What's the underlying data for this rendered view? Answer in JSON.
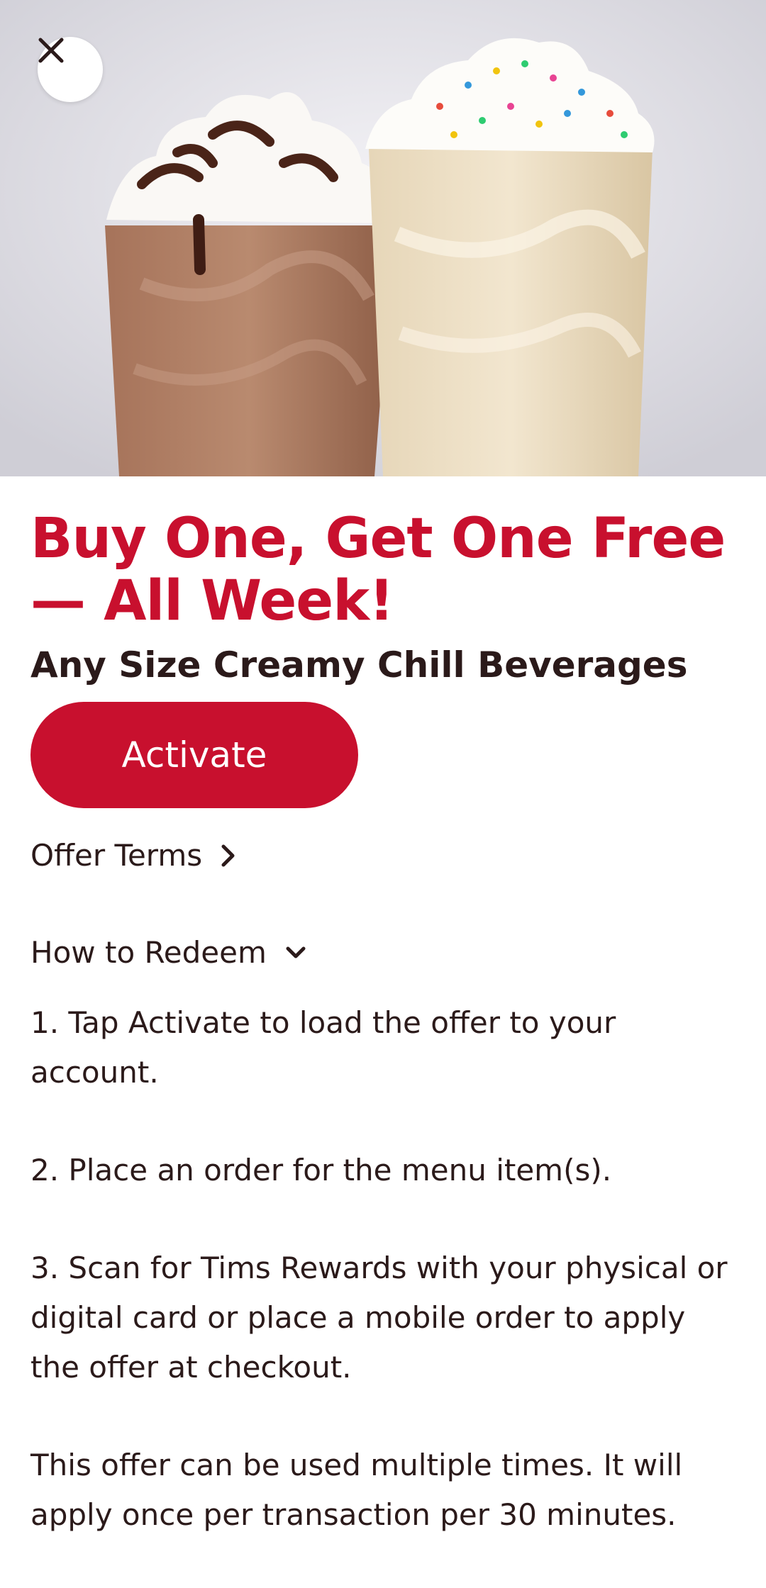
{
  "hero": {
    "image": "two-creamy-chill-beverages-photo"
  },
  "close_icon": "close-icon",
  "offer": {
    "title": "Buy One, Get One Free — All Week!",
    "subtitle": "Any Size Creamy Chill Beverages",
    "activate_label": "Activate"
  },
  "links": {
    "offer_terms": "Offer Terms",
    "how_to_redeem": "How to Redeem"
  },
  "steps": [
    "1. Tap Activate to load the offer to your account.",
    "2. Place an order for the menu item(s).",
    "3. Scan for Tims Rewards with your physical or digital card or place a mobile order to apply the offer at checkout.",
    "This offer can be used multiple times. It will apply once per transaction per 30 minutes."
  ],
  "colors": {
    "brand_red": "#c8102e",
    "text_dark": "#2b1a1a"
  }
}
